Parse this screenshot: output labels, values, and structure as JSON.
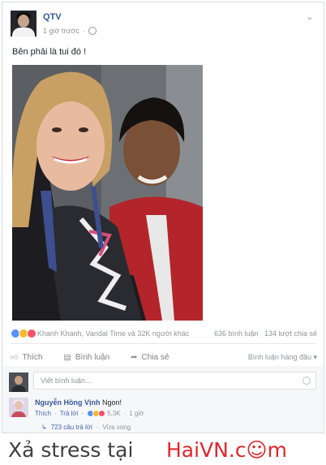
{
  "post": {
    "author": "QTV",
    "time": "1 giờ trước",
    "privacy_icon": "globe-icon",
    "menu_icon": "chevron-down-icon",
    "text": "Bên phải là tui đó !"
  },
  "reactions": {
    "icons": [
      "like-icon",
      "haha-icon",
      "love-icon"
    ],
    "names": "Khanh Khanh, Vandal Time và 32K người khác",
    "comments_count": "636 bình luận",
    "shares_count": "134 lượt chia sẻ"
  },
  "actions": {
    "like": "Thích",
    "comment": "Bình luận",
    "share": "Chia sẻ",
    "sort": "Bình luận hàng đầu ▾"
  },
  "comment_box": {
    "placeholder": "Viết bình luận..."
  },
  "comment": {
    "author": "Nguyễn Hồng Vịnh",
    "text": "Ngon!",
    "like": "Thích",
    "reply": "Trả lời",
    "reaction_count": "5,3K",
    "time": "1 giờ",
    "replies_label": "723 câu trả lời",
    "replies_time": "Vừa xong"
  },
  "watermark": {
    "left": "Xả stress tại",
    "right": "HaiVN.c☺m"
  },
  "colors": {
    "link_blue": "#365899",
    "meta_gray": "#90949c",
    "like_blue": "#5890ff",
    "watermark_red": "#e0262b"
  }
}
